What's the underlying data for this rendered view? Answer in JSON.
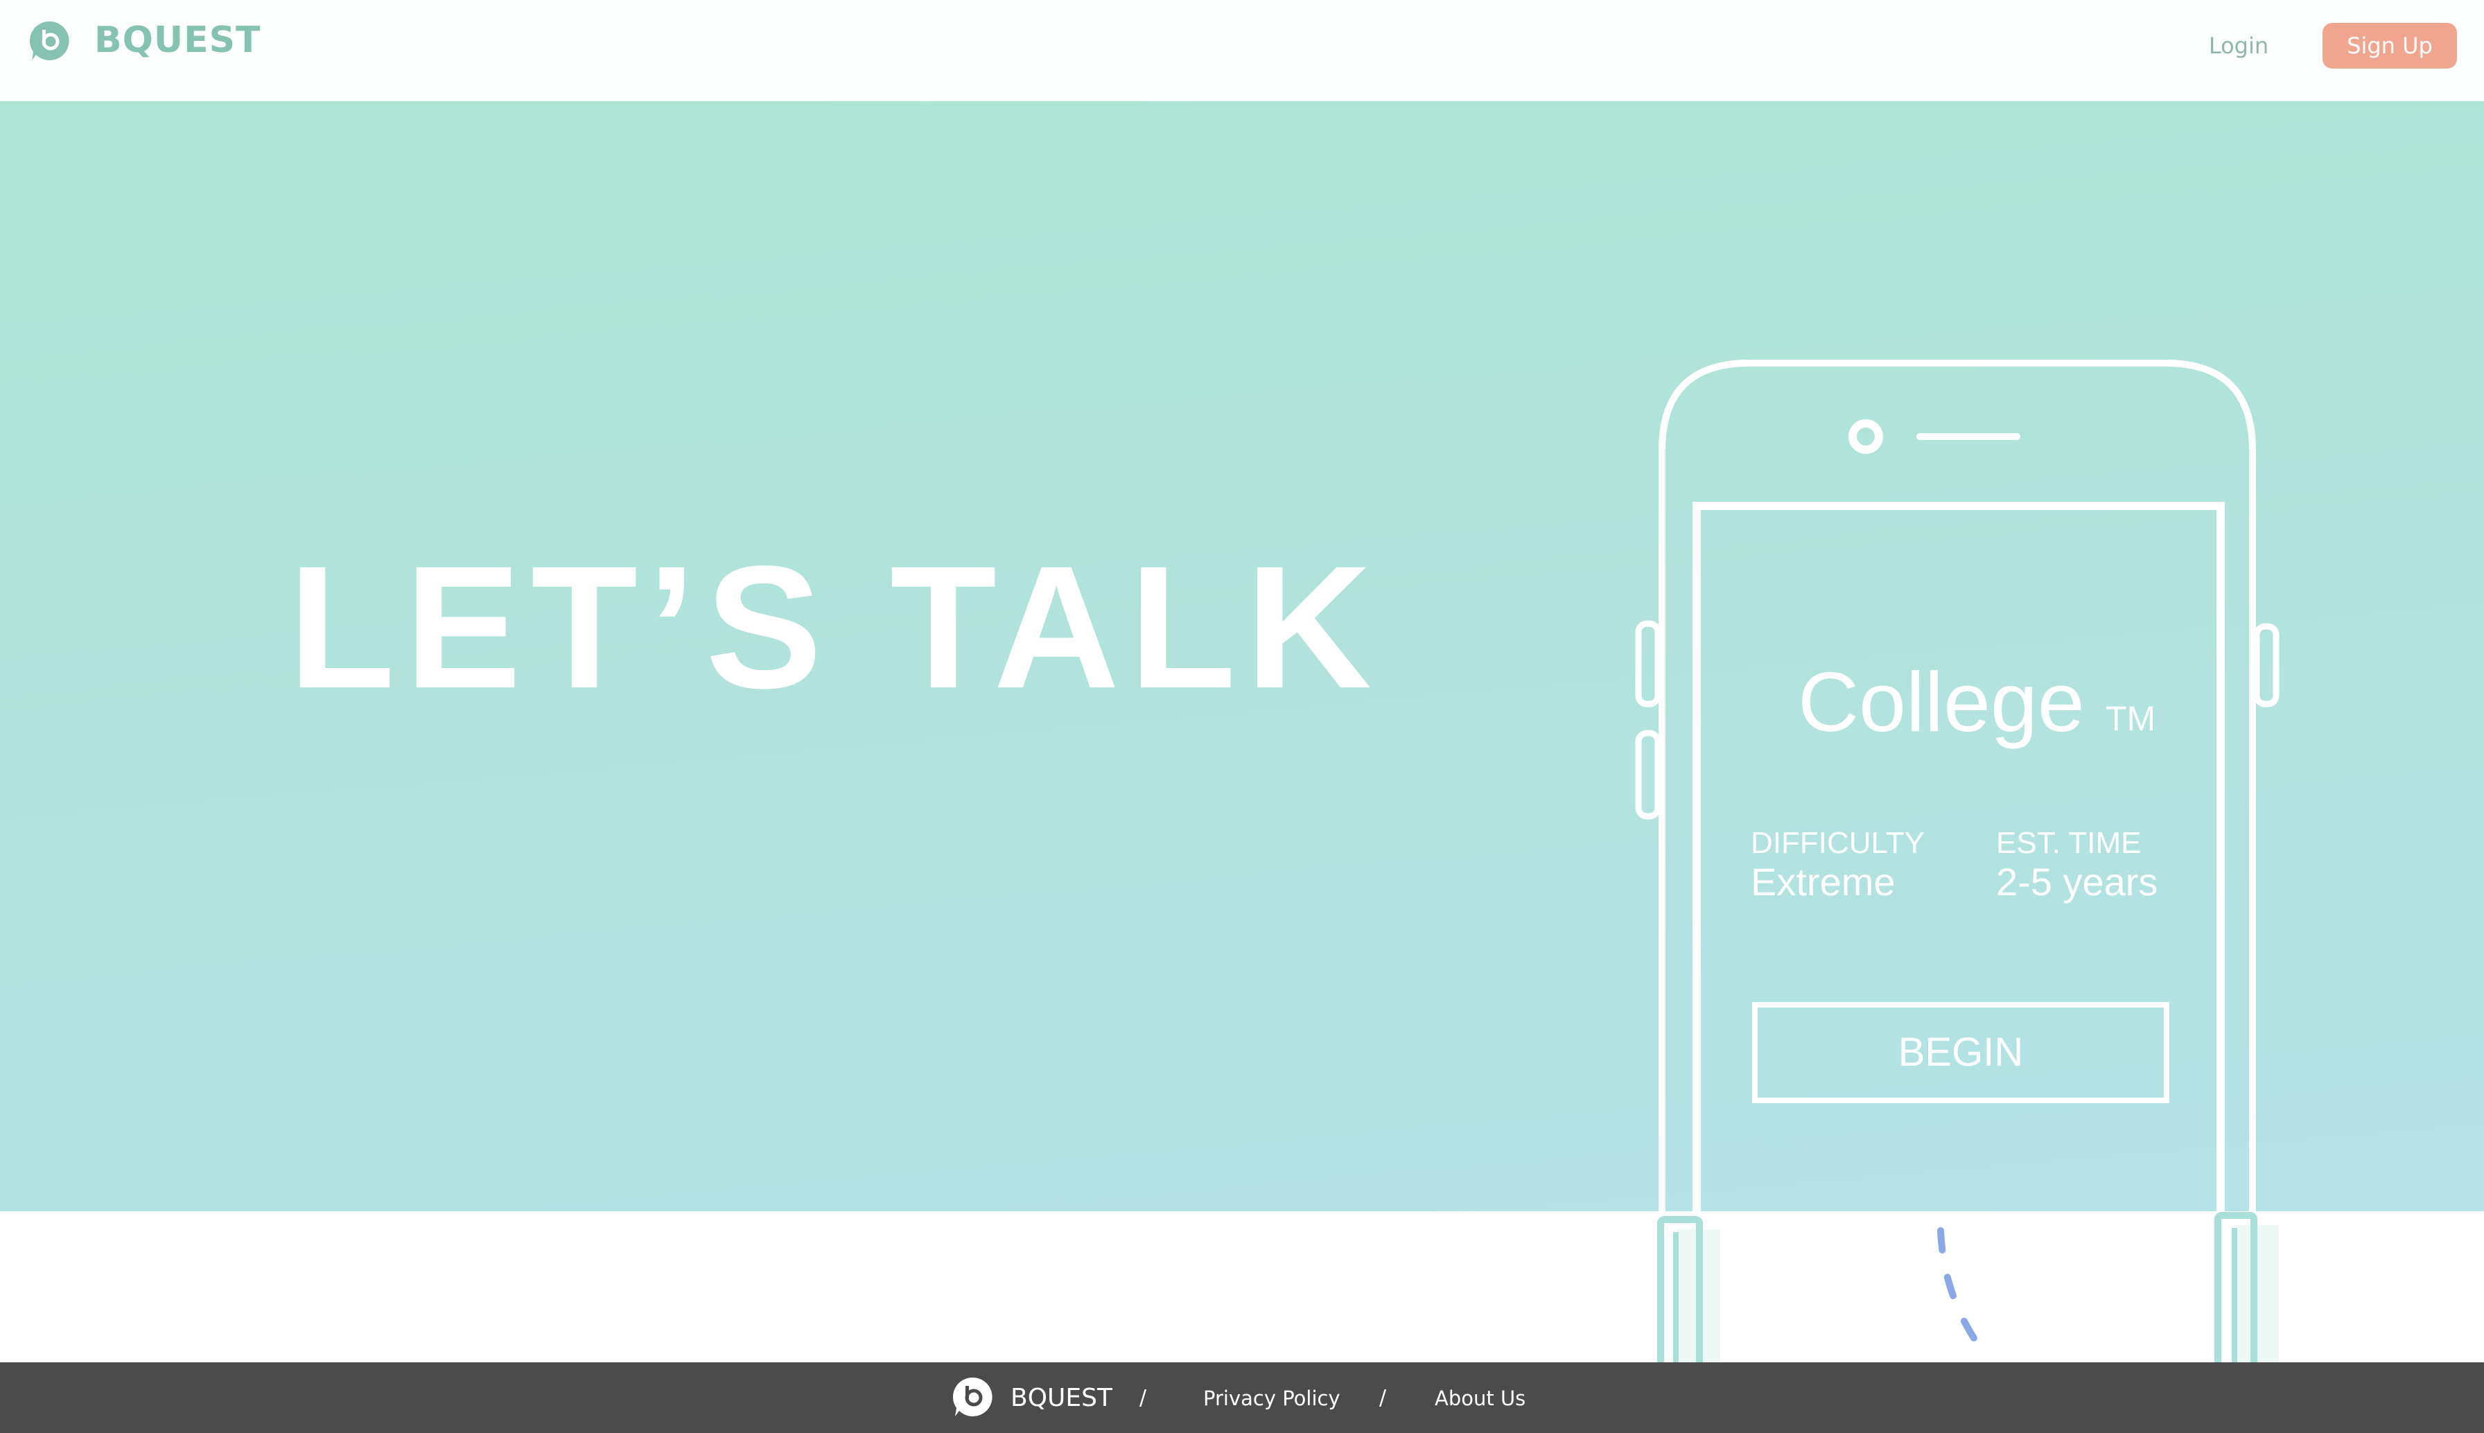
{
  "header": {
    "brand": "BQUEST",
    "login_label": "Login",
    "signup_label": "Sign Up",
    "logo_icon": "speech-bubble-b-icon"
  },
  "hero": {
    "title": "LET’S TALK"
  },
  "phone_card": {
    "title": "College",
    "trademark": "TM",
    "difficulty_label": "DIFFICULTY",
    "difficulty_value": "Extreme",
    "time_label": "EST. TIME",
    "time_value": "2-5 years",
    "begin_label": "BEGIN"
  },
  "footer": {
    "brand": "BQUEST",
    "separator": "/",
    "privacy_label": "Privacy Policy",
    "about_label": "About Us"
  },
  "colors": {
    "brand_teal": "#86c2b2",
    "accent_salmon": "#f0a58e",
    "hero_gradient_top": "#ade5d4",
    "hero_gradient_bottom": "#b4e2e6",
    "footer_bg": "#4b4b4b",
    "dashed_line": "#8aa8e6"
  }
}
